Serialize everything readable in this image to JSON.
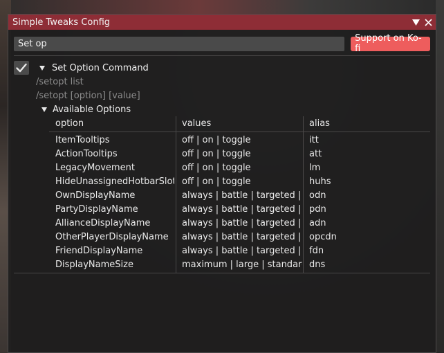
{
  "window": {
    "title": "Simple Tweaks Config",
    "collapse_icon": "triangle-down-icon",
    "close_icon": "close-x-icon"
  },
  "search": {
    "value": "Set op",
    "placeholder": ""
  },
  "kofi_button": "Support on Ko-fi",
  "tweak": {
    "enabled": true,
    "name": "Set Option Command",
    "commands": [
      "/setopt list",
      "/setopt [option] [value]"
    ],
    "options_label": "Available Options"
  },
  "table": {
    "headers": [
      "option",
      "values",
      "alias"
    ],
    "rows": [
      {
        "option": "ItemTooltips",
        "values": "off | on | toggle",
        "alias": "itt"
      },
      {
        "option": "ActionTooltips",
        "values": "off | on | toggle",
        "alias": "att"
      },
      {
        "option": "LegacyMovement",
        "values": "off | on | toggle",
        "alias": "lm"
      },
      {
        "option": "HideUnassignedHotbarSlots",
        "values": "off | on | toggle",
        "alias": "huhs"
      },
      {
        "option": "OwnDisplayName",
        "values": "always | battle | targeted | ne",
        "alias": "odn"
      },
      {
        "option": "PartyDisplayName",
        "values": "always | battle | targeted | ne",
        "alias": "pdn"
      },
      {
        "option": "AllianceDisplayName",
        "values": "always | battle | targeted | ne",
        "alias": "adn"
      },
      {
        "option": "OtherPlayerDisplayName",
        "values": "always | battle | targeted | ne",
        "alias": "opcdn"
      },
      {
        "option": "FriendDisplayName",
        "values": "always | battle | targeted | ne",
        "alias": "fdn"
      },
      {
        "option": "DisplayNameSize",
        "values": "maximum | large | standard",
        "alias": "dns"
      }
    ]
  },
  "colors": {
    "titlebar": "#8e2d36",
    "kofi": "#ee5d5d",
    "window_bg": "#201f1f",
    "muted_text": "#8d8d8d"
  }
}
